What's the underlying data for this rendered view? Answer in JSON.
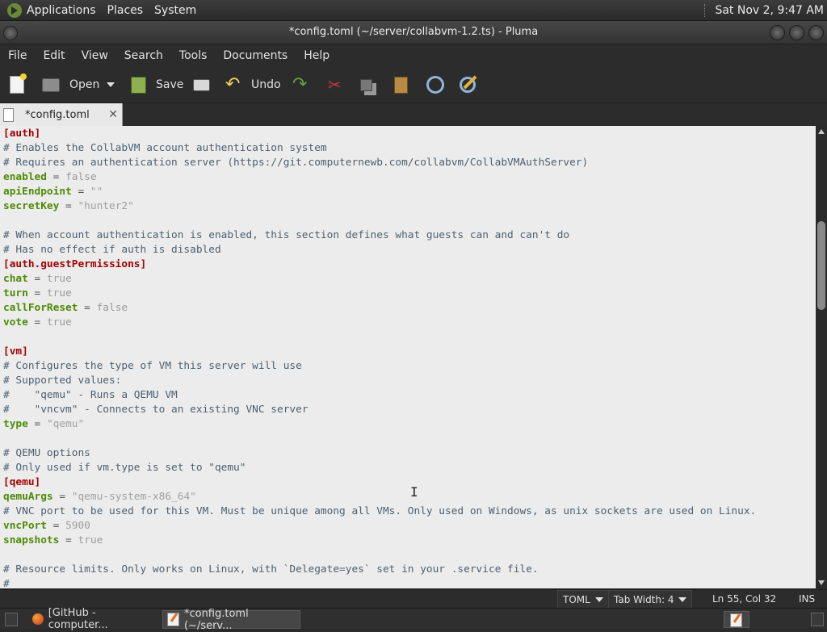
{
  "top_panel": {
    "menus": [
      "Applications",
      "Places",
      "System"
    ],
    "clock": "Sat Nov 2,  9:47 AM"
  },
  "window": {
    "title": "*config.toml (~/server/collabvm-1.2.ts) - Pluma"
  },
  "menubar": [
    "File",
    "Edit",
    "View",
    "Search",
    "Tools",
    "Documents",
    "Help"
  ],
  "toolbar": {
    "open_label": "Open",
    "save_label": "Save",
    "undo_label": "Undo"
  },
  "tab": {
    "label": "*config.toml",
    "close": "✕"
  },
  "code_lines": [
    [
      [
        "section",
        "[auth]"
      ]
    ],
    [
      [
        "comment",
        "# Enables the CollabVM account authentication system"
      ]
    ],
    [
      [
        "comment",
        "# Requires an authentication server (https://git.computernewb.com/collabvm/CollabVMAuthServer)"
      ]
    ],
    [
      [
        "key",
        "enabled"
      ],
      [
        "eq",
        " = "
      ],
      [
        "val",
        "false"
      ]
    ],
    [
      [
        "key",
        "apiEndpoint"
      ],
      [
        "eq",
        " = "
      ],
      [
        "str",
        "\"\""
      ]
    ],
    [
      [
        "key",
        "secretKey"
      ],
      [
        "eq",
        " = "
      ],
      [
        "str",
        "\"hunter2\""
      ]
    ],
    [],
    [
      [
        "comment",
        "# When account authentication is enabled, this section defines what guests can and can't do"
      ]
    ],
    [
      [
        "comment",
        "# Has no effect if auth is disabled"
      ]
    ],
    [
      [
        "section",
        "[auth.guestPermissions]"
      ]
    ],
    [
      [
        "key",
        "chat"
      ],
      [
        "eq",
        " = "
      ],
      [
        "val",
        "true"
      ]
    ],
    [
      [
        "key",
        "turn"
      ],
      [
        "eq",
        " = "
      ],
      [
        "val",
        "true"
      ]
    ],
    [
      [
        "key",
        "callForReset"
      ],
      [
        "eq",
        " = "
      ],
      [
        "val",
        "false"
      ]
    ],
    [
      [
        "key",
        "vote"
      ],
      [
        "eq",
        " = "
      ],
      [
        "val",
        "true"
      ]
    ],
    [],
    [
      [
        "section",
        "[vm]"
      ]
    ],
    [
      [
        "comment",
        "# Configures the type of VM this server will use"
      ]
    ],
    [
      [
        "comment",
        "# Supported values:"
      ]
    ],
    [
      [
        "comment",
        "#    \"qemu\" - Runs a QEMU VM"
      ]
    ],
    [
      [
        "comment",
        "#    \"vncvm\" - Connects to an existing VNC server"
      ]
    ],
    [
      [
        "key",
        "type"
      ],
      [
        "eq",
        " = "
      ],
      [
        "str",
        "\"qemu\""
      ]
    ],
    [],
    [
      [
        "comment",
        "# QEMU options"
      ]
    ],
    [
      [
        "comment",
        "# Only used if vm.type is set to \"qemu\""
      ]
    ],
    [
      [
        "section",
        "[qemu]"
      ]
    ],
    [
      [
        "key",
        "qemuArgs"
      ],
      [
        "eq",
        " = "
      ],
      [
        "str",
        "\"qemu-system-x86_64\""
      ]
    ],
    [
      [
        "comment",
        "# VNC port to be used for this VM. Must be unique among all VMs. Only used on Windows, as unix sockets are used on Linux."
      ]
    ],
    [
      [
        "key",
        "vncPort"
      ],
      [
        "eq",
        " = "
      ],
      [
        "num",
        "5900"
      ]
    ],
    [
      [
        "key",
        "snapshots"
      ],
      [
        "eq",
        " = "
      ],
      [
        "val",
        "true"
      ]
    ],
    [],
    [
      [
        "comment",
        "# Resource limits. Only works on Linux, with `Delegate=yes` set in your .service file."
      ]
    ],
    [
      [
        "comment",
        "#"
      ]
    ]
  ],
  "statusbar": {
    "language": "TOML",
    "tab_width": "Tab Width:  4",
    "position": "Ln 55, Col 32",
    "mode": "INS"
  },
  "taskbar": {
    "tasks": [
      "[GitHub - computer...",
      "*config.toml (~/serv..."
    ]
  },
  "colors": {
    "section": "#a40000",
    "key": "#4e8a06",
    "comment": "#4d6070",
    "value": "#9a9a9a",
    "editor_bg": "#ececec"
  }
}
